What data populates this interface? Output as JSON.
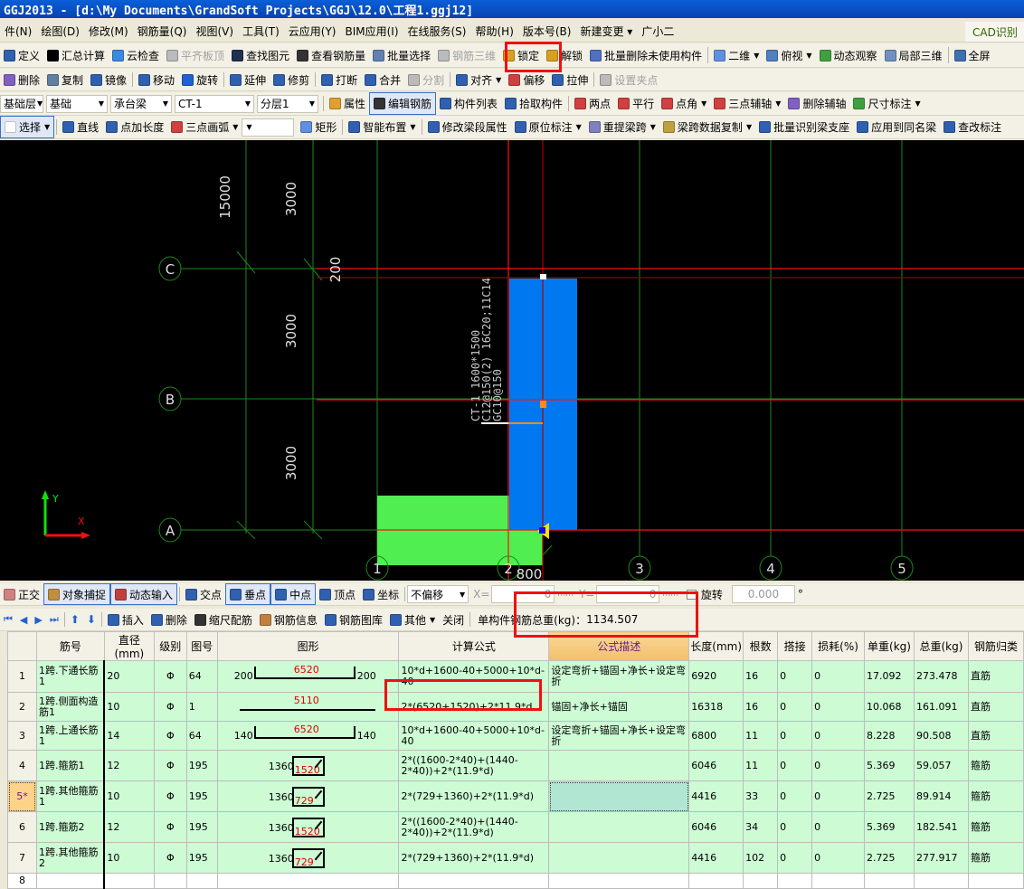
{
  "window": {
    "title": "GGJ2013 - [d:\\My Documents\\GrandSoft Projects\\GGJ\\12.0\\工程1.ggj12]"
  },
  "menu": [
    "件(N)",
    "绘图(D)",
    "修改(M)",
    "钢筋量(Q)",
    "视图(V)",
    "工具(T)",
    "云应用(Y)",
    "BIM应用(I)",
    "在线服务(S)",
    "帮助(H)",
    "版本号(B)",
    "新建变更 ▾",
    "广小二"
  ],
  "cad_tab": "CAD识别",
  "toolbar1": [
    {
      "label": "定义",
      "icon": "define-icon",
      "color": "#3060b0"
    },
    {
      "label": "汇总计算",
      "icon": "sigma-icon",
      "color": "#000"
    },
    {
      "label": "云检查",
      "icon": "cloud-check-icon",
      "color": "#3a8ae0"
    },
    {
      "label": "平齐板顶",
      "icon": "align-slab-icon",
      "color": "#bbb",
      "disabled": true
    },
    {
      "label": "查找图元",
      "icon": "binoculars-icon",
      "color": "#203050"
    },
    {
      "label": "查看钢筋量",
      "icon": "glasses-icon",
      "color": "#333"
    },
    {
      "label": "批量选择",
      "icon": "batch-select-icon",
      "color": "#6080b0"
    },
    {
      "label": "钢筋三维",
      "icon": "rebar-3d-icon",
      "color": "#bbb",
      "disabled": true
    },
    {
      "label": "锁定",
      "icon": "lock-icon",
      "color": "#d8a020"
    },
    {
      "label": "解锁",
      "icon": "unlock-icon",
      "color": "#d8a020"
    },
    {
      "label": "批量删除未使用构件",
      "icon": "batch-delete-icon",
      "color": "#5070c0"
    },
    {
      "sep": true
    },
    {
      "label": "二维",
      "icon": "2d-view-icon",
      "color": "#6090e0",
      "dropdown": true
    },
    {
      "label": "俯视",
      "icon": "top-view-icon",
      "color": "#5080c0",
      "dropdown": true
    },
    {
      "label": "动态观察",
      "icon": "orbit-icon",
      "color": "#40a040"
    },
    {
      "label": "局部三维",
      "icon": "local-3d-icon",
      "color": "#7090c0"
    },
    {
      "sep": true
    },
    {
      "label": "全屏",
      "icon": "fullscreen-icon",
      "color": "#4070b0"
    }
  ],
  "toolbar2": [
    {
      "label": "删除",
      "icon": "eraser-icon",
      "color": "#8060c0"
    },
    {
      "label": "复制",
      "icon": "copy-icon",
      "color": "#6080a0"
    },
    {
      "label": "镜像",
      "icon": "mirror-icon",
      "color": "#3060b0"
    },
    {
      "sep": true
    },
    {
      "label": "移动",
      "icon": "move-icon",
      "color": "#3060b0"
    },
    {
      "label": "旋转",
      "icon": "rotate-icon",
      "color": "#2060d0"
    },
    {
      "sep": true
    },
    {
      "label": "延伸",
      "icon": "extend-icon",
      "color": "#3060b0"
    },
    {
      "label": "修剪",
      "icon": "trim-icon",
      "color": "#3060b0"
    },
    {
      "sep": true
    },
    {
      "label": "打断",
      "icon": "break-icon",
      "color": "#3060b0"
    },
    {
      "label": "合并",
      "icon": "merge-icon",
      "color": "#3060b0"
    },
    {
      "label": "分割",
      "icon": "split-icon",
      "color": "#bbb",
      "disabled": true
    },
    {
      "sep": true
    },
    {
      "label": "对齐",
      "icon": "align-icon",
      "color": "#3060b0",
      "dropdown": true
    },
    {
      "label": "偏移",
      "icon": "offset-icon",
      "color": "#d04040"
    },
    {
      "label": "拉伸",
      "icon": "stretch-icon",
      "color": "#3060b0"
    },
    {
      "sep": true
    },
    {
      "label": "设置夹点",
      "icon": "grip-icon",
      "color": "#bbb",
      "disabled": true
    }
  ],
  "toolbar3": {
    "combos": [
      "基础层",
      "基础",
      "承台梁",
      "CT-1",
      "分层1"
    ],
    "items": [
      {
        "label": "属性",
        "icon": "property-icon",
        "color": "#e0a030"
      },
      {
        "label": "编辑钢筋",
        "icon": "edit-rebar-icon",
        "color": "#333",
        "active": true
      },
      {
        "label": "构件列表",
        "icon": "component-list-icon",
        "color": "#3060b0"
      },
      {
        "label": "拾取构件",
        "icon": "pick-icon",
        "color": "#3060b0"
      },
      {
        "sep": true
      },
      {
        "label": "两点",
        "icon": "two-point-icon",
        "color": "#d04040"
      },
      {
        "label": "平行",
        "icon": "parallel-icon",
        "color": "#d04040"
      },
      {
        "label": "点角",
        "icon": "point-angle-icon",
        "color": "#d04040",
        "dropdown": true
      },
      {
        "label": "三点辅轴",
        "icon": "three-point-axis-icon",
        "color": "#d04040",
        "dropdown": true
      },
      {
        "label": "删除辅轴",
        "icon": "delete-axis-icon",
        "color": "#8060c0"
      },
      {
        "label": "尺寸标注",
        "icon": "dimension-icon",
        "color": "#40a040",
        "dropdown": true
      }
    ]
  },
  "toolbar4": [
    {
      "label": "选择",
      "icon": "cursor-icon",
      "color": "#fff",
      "active": true,
      "dropdown": true
    },
    {
      "sep": true
    },
    {
      "label": "直线",
      "icon": "line-icon",
      "color": "#3060b0"
    },
    {
      "label": "点加长度",
      "icon": "point-length-icon",
      "color": "#3060b0"
    },
    {
      "label": "三点画弧",
      "icon": "arc-icon",
      "color": "#d04040",
      "dropdown": true
    },
    {
      "combo": ""
    },
    {
      "label": "矩形",
      "icon": "rectangle-icon",
      "color": "#6090e0"
    },
    {
      "sep": true
    },
    {
      "label": "智能布置",
      "icon": "smart-layout-icon",
      "color": "#3060b0",
      "dropdown": true
    },
    {
      "sep": true
    },
    {
      "label": "修改梁段属性",
      "icon": "modify-beam-icon",
      "color": "#3060b0"
    },
    {
      "label": "原位标注",
      "icon": "in-situ-label-icon",
      "color": "#3060b0",
      "dropdown": true
    },
    {
      "label": "重提梁跨",
      "icon": "re-span-icon",
      "color": "#8080c0",
      "dropdown": true
    },
    {
      "label": "梁跨数据复制",
      "icon": "brush-icon",
      "color": "#c0a040",
      "dropdown": true
    },
    {
      "label": "批量识别梁支座",
      "icon": "batch-support-icon",
      "color": "#3060b0"
    },
    {
      "label": "应用到同名梁",
      "icon": "apply-same-icon",
      "color": "#3060b0"
    },
    {
      "label": "查改标注",
      "icon": "check-label-icon",
      "color": "#3060b0"
    }
  ],
  "canvas": {
    "axes_h": [
      "C",
      "B",
      "A"
    ],
    "axes_v": [
      "1",
      "2",
      "3",
      "4",
      "5"
    ],
    "dims": {
      "total": "15000",
      "seg1": "3000",
      "seg2": "3000",
      "seg3": "3000",
      "offset_top": "200",
      "offset_bottom": "800"
    },
    "beam_label": [
      "CT-1 1600*1500",
      "C12@150(2) 16C20;11C14",
      "GC10@150"
    ],
    "coord_x": "X",
    "coord_y": "Y",
    "colors": {
      "beam": "#0078f0",
      "cap": "#50ee50",
      "grid": "#1a8a1a",
      "selection": "#ff1010"
    }
  },
  "snapbar": {
    "items": [
      {
        "label": "正交",
        "icon": "ortho-icon",
        "color": "#d08080"
      },
      {
        "label": "对象捕捉",
        "icon": "object-snap-icon",
        "color": "#c09040",
        "active": true
      },
      {
        "label": "动态输入",
        "icon": "dynamic-input-icon",
        "color": "#c04040",
        "active": true
      },
      {
        "sep": true
      },
      {
        "label": "交点",
        "icon": "intersection-icon",
        "color": "#3060b0"
      },
      {
        "label": "垂点",
        "icon": "perpendicular-icon",
        "color": "#3060b0",
        "active": true
      },
      {
        "label": "中点",
        "icon": "midpoint-icon",
        "color": "#3060b0",
        "active": true
      },
      {
        "label": "顶点",
        "icon": "vertex-icon",
        "color": "#3060b0"
      },
      {
        "label": "坐标",
        "icon": "coordinate-icon",
        "color": "#3060b0"
      }
    ],
    "offset_mode": "不偏移",
    "x_label": "X=",
    "x_value": "0",
    "y_label": "Y=",
    "y_value": "0",
    "unit": "mm",
    "rotate_label": "旋转",
    "rotate_value": "0.000",
    "degree": "°"
  },
  "rebar_toolbar": {
    "items": [
      {
        "label": "插入",
        "icon": "insert-row-icon",
        "color": "#3060b0"
      },
      {
        "label": "删除",
        "icon": "delete-row-icon",
        "color": "#3060b0"
      },
      {
        "label": "缩尺配筋",
        "icon": "scale-rebar-icon",
        "color": "#333"
      },
      {
        "label": "钢筋信息",
        "icon": "rebar-info-icon",
        "color": "#c08040"
      },
      {
        "label": "钢筋图库",
        "icon": "rebar-library-icon",
        "color": "#3060b0"
      },
      {
        "label": "其他",
        "icon": "other-icon",
        "color": "#3060b0",
        "dropdown": true
      },
      {
        "label": "关闭",
        "icon": "",
        "color": ""
      }
    ],
    "total_weight_label": "单构件钢筋总重(kg)：",
    "total_weight": "1134.507"
  },
  "table": {
    "headers": [
      "",
      "筋号",
      "直径(mm)",
      "级别",
      "图号",
      "图形",
      "计算公式",
      "公式描述",
      "长度(mm)",
      "根数",
      "搭接",
      "损耗(%)",
      "单重(kg)",
      "总重(kg)",
      "钢筋归类"
    ],
    "rows": [
      {
        "n": "1",
        "name": "1跨.下通长筋1",
        "dia": "20",
        "grade": "Φ",
        "fig": "64",
        "shape": {
          "type": "bent",
          "left": "200",
          "mid": "6520",
          "right": "200"
        },
        "formula": "10*d+1600-40+5000+10*d-40",
        "desc": "设定弯折+锚固+净长+设定弯折",
        "len": "6920",
        "count": "16",
        "lap": "0",
        "loss": "0",
        "unit_w": "17.092",
        "total_w": "273.478",
        "cat": "直筋"
      },
      {
        "n": "2",
        "name": "1跨.侧面构造筋1",
        "dia": "10",
        "grade": "Φ",
        "fig": "1",
        "shape": {
          "type": "straight",
          "mid": "5110"
        },
        "formula": "2*(6520+1520)+2*11.9*d",
        "desc": "锚固+净长+锚固",
        "len": "16318",
        "count": "16",
        "lap": "0",
        "loss": "0",
        "unit_w": "10.068",
        "total_w": "161.091",
        "cat": "直筋"
      },
      {
        "n": "3",
        "name": "1跨.上通长筋1",
        "dia": "14",
        "grade": "Φ",
        "fig": "64",
        "shape": {
          "type": "bent",
          "left": "140",
          "mid": "6520",
          "right": "140"
        },
        "formula": "10*d+1600-40+5000+10*d-40",
        "desc": "设定弯折+锚固+净长+设定弯折",
        "len": "6800",
        "count": "11",
        "lap": "0",
        "loss": "0",
        "unit_w": "8.228",
        "total_w": "90.508",
        "cat": "直筋"
      },
      {
        "n": "4",
        "name": "1跨.箍筋1",
        "dia": "12",
        "grade": "Φ",
        "fig": "195",
        "shape": {
          "type": "stirrup",
          "left": "1360",
          "mid": "1520"
        },
        "formula": "2*((1600-2*40)+(1440-2*40))+2*(11.9*d)",
        "desc": "",
        "len": "6046",
        "count": "11",
        "lap": "0",
        "loss": "0",
        "unit_w": "5.369",
        "total_w": "59.057",
        "cat": "箍筋"
      },
      {
        "n": "5*",
        "name": "1跨.其他箍筋1",
        "dia": "10",
        "grade": "Φ",
        "fig": "195",
        "shape": {
          "type": "stirrup",
          "left": "1360",
          "mid": "729"
        },
        "formula": "2*(729+1360)+2*(11.9*d)",
        "desc": "",
        "len": "4416",
        "count": "33",
        "lap": "0",
        "loss": "0",
        "unit_w": "2.725",
        "total_w": "89.914",
        "cat": "箍筋",
        "selected": true
      },
      {
        "n": "6",
        "name": "1跨.箍筋2",
        "dia": "12",
        "grade": "Φ",
        "fig": "195",
        "shape": {
          "type": "stirrup",
          "left": "1360",
          "mid": "1520"
        },
        "formula": "2*((1600-2*40)+(1440-2*40))+2*(11.9*d)",
        "desc": "",
        "len": "6046",
        "count": "34",
        "lap": "0",
        "loss": "0",
        "unit_w": "5.369",
        "total_w": "182.541",
        "cat": "箍筋"
      },
      {
        "n": "7",
        "name": "1跨.其他箍筋2",
        "dia": "10",
        "grade": "Φ",
        "fig": "195",
        "shape": {
          "type": "stirrup",
          "left": "1360",
          "mid": "729"
        },
        "formula": "2*(729+1360)+2*(11.9*d)",
        "desc": "",
        "len": "4416",
        "count": "102",
        "lap": "0",
        "loss": "0",
        "unit_w": "2.725",
        "total_w": "277.917",
        "cat": "箍筋"
      },
      {
        "n": "8",
        "empty": true
      }
    ]
  }
}
